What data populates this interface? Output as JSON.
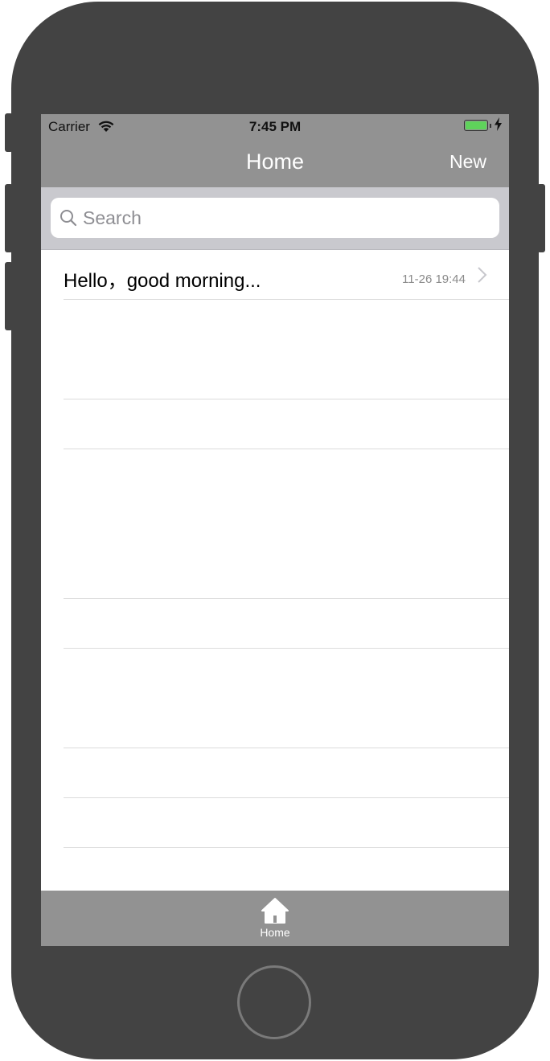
{
  "status_bar": {
    "carrier": "Carrier",
    "time": "7:45 PM",
    "wifi_icon": "wifi-icon",
    "battery_icon": "battery-charging-icon",
    "battery_color": "#5fd35b"
  },
  "nav_bar": {
    "title": "Home",
    "new_label": "New",
    "background": "#929292"
  },
  "search": {
    "placeholder": "Search",
    "value": "",
    "icon": "search-icon"
  },
  "list": {
    "items": [
      {
        "title": "Hello，good morning...",
        "time": "11-26 19:44",
        "icon": "chevron-right-icon"
      }
    ]
  },
  "tab_bar": {
    "items": [
      {
        "label": "Home",
        "icon": "home-icon"
      }
    ]
  }
}
